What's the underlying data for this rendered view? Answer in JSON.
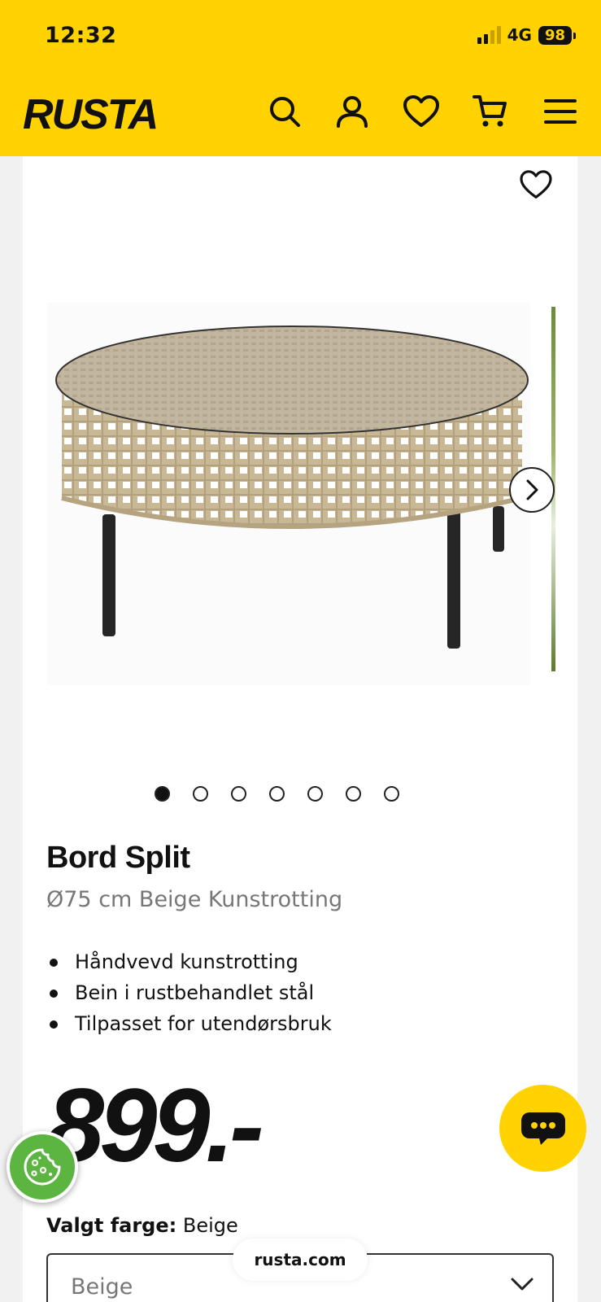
{
  "status_bar": {
    "time": "12:32",
    "network": "4G",
    "battery": "98"
  },
  "header": {
    "brand": "RUSTA",
    "icons": [
      "search-icon",
      "account-icon",
      "heart-icon",
      "cart-icon",
      "menu-icon"
    ],
    "background": "#ffd200"
  },
  "gallery": {
    "total_images": 7,
    "active_index": 0
  },
  "product": {
    "title": "Bord Split",
    "subtitle": "Ø75 cm Beige Kunstrotting",
    "bullets": [
      "Håndvevd kunstrotting",
      "Bein i rustbehandlet stål",
      "Tilpasset for utendørsbruk"
    ],
    "price": "899.-",
    "color_label": "Valgt farge:",
    "color_value": "Beige",
    "color_select_value": "Beige"
  },
  "browser": {
    "url": "rusta.com"
  },
  "colors": {
    "accent": "#ffd200",
    "cookie": "#5cb540"
  }
}
